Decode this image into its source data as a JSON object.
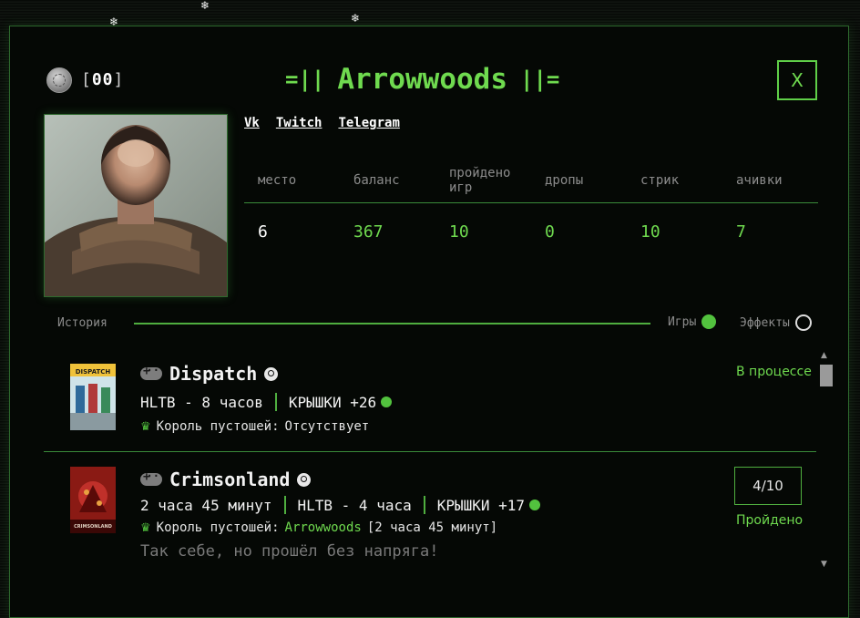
{
  "header": {
    "coin_count_prefix": "[",
    "coin_count": "00",
    "coin_count_suffix": "]",
    "title": "Arrowwoods",
    "title_deco_left": "=||",
    "title_deco_right": "||=",
    "close_label": "X"
  },
  "links": [
    "Vk",
    "Twitch",
    "Telegram"
  ],
  "stats": {
    "headers": [
      "место",
      "баланс",
      "пройдено игр",
      "дропы",
      "стрик",
      "ачивки"
    ],
    "values": [
      "6",
      "367",
      "10",
      "0",
      "10",
      "7"
    ]
  },
  "history": {
    "label": "История",
    "tab_games": "Игры",
    "tab_effects": "Эффекты"
  },
  "games": [
    {
      "title": "Dispatch",
      "cover_text": "DISPATCH",
      "hltb": "HLTB - 8 часов",
      "caps": "КРЫШКИ +26",
      "king_label": "Король пустошей:",
      "king_value": "Отсутствует",
      "status": "В процессе"
    },
    {
      "title": "Crimsonland",
      "cover_text": "CRIMSONLAND",
      "time": "2 часа 45 минут",
      "hltb": "HLTB - 4 часа",
      "caps": "КРЫШКИ +17",
      "king_label": "Король пустошей:",
      "king_value": "Arrowwoods",
      "king_time": "[2 часа 45 минут]",
      "comment": "Так себе, но прошёл без напряга!",
      "rating": "4/10",
      "status": "Пройдено"
    }
  ],
  "colors": {
    "accent": "#6fda4f",
    "background": "#050805",
    "border": "#2e6a2e"
  }
}
